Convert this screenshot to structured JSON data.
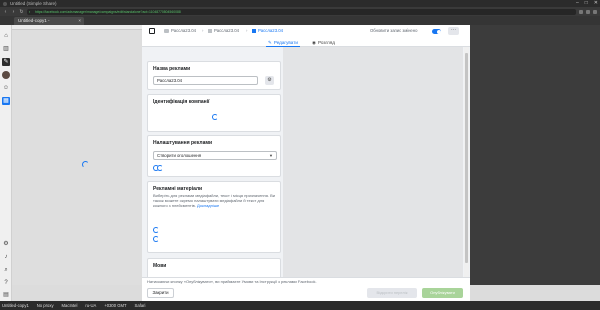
{
  "browser": {
    "window_title": "Untitled (Simple Share)",
    "url": "https://facebook.com/adsmanager/manage/campaigns/edit/standalone?act=11048770804560088",
    "tab_label": "Untitled-copy1 - www.facebook.com"
  },
  "editor": {
    "breadcrumbs": [
      "Рассла23.04",
      "Рассла23.04",
      "Рассла23.04"
    ],
    "autosave_label": "Обновити запис змінено",
    "mode_edit": "Редагувати",
    "mode_preview": "Розгляд"
  },
  "cards": {
    "ad_name": {
      "title": "Назва реклами",
      "value": "Рассла23.04"
    },
    "company_id": {
      "title": "Ідентифікація компанії"
    },
    "ad_setup": {
      "title": "Налаштування реклами",
      "select_value": "Створити оголошення"
    },
    "creative": {
      "title": "Рекламні матеріали",
      "description": "Виберіть для реклами медіафайли, текст і місця призначення. Ви також можете окремо налаштувати медіафайли й текст для кожного з плейсментів.",
      "link": "Докладніше"
    },
    "languages": {
      "title": "Мови"
    }
  },
  "footer": {
    "notice": "Натискаючи кнопку «Опублікувати», ви приймаєте Умови та Інструкції з реклами Facebook.",
    "close_label": "Закрити",
    "review_label": "Відкрити перелік",
    "publish_label": "Опублікувати"
  },
  "statusbar": {
    "items": [
      "Untitled-copy1",
      "No proxy",
      "MacIntel",
      "ru-UA",
      "+0300 GMT",
      "Safari"
    ]
  },
  "colors": {
    "accent": "#1877f2",
    "publish": "#a9d49a",
    "url_text": "#58c06a"
  }
}
